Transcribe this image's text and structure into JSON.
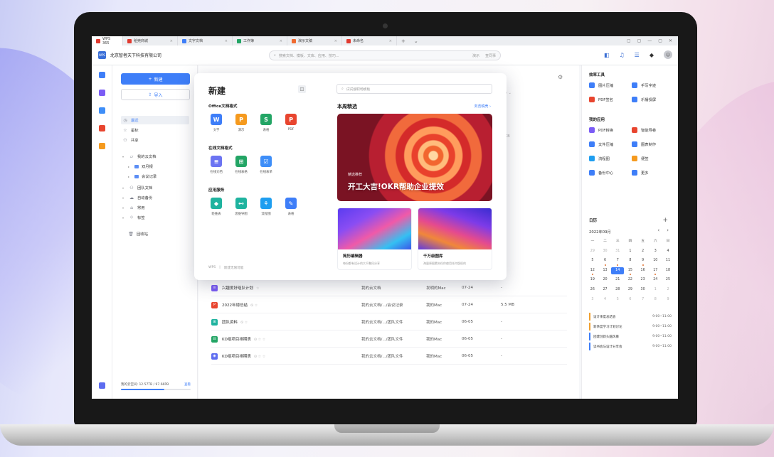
{
  "tabs": [
    {
      "label": "WPS 365",
      "color": "#e13a2f"
    },
    {
      "label": "稻壳商城",
      "color": "#e13a2f"
    },
    {
      "label": "文字文档",
      "color": "#3e7ef8"
    },
    {
      "label": "工作簿",
      "color": "#23a565"
    },
    {
      "label": "演示文稿",
      "color": "#f06a2f"
    },
    {
      "label": "未命名",
      "color": "#e13a2f"
    }
  ],
  "tab_plus": "+",
  "tab_more": "⌄",
  "window_controls": [
    "▢",
    "▢",
    "—",
    "▢",
    "✕"
  ],
  "header": {
    "org_logo": "WPS",
    "org_name": "北京智者天下科技有限公司",
    "search_placeholder": "搜索文档、模板、文库、应用、技巧...",
    "search_opt1": "演示",
    "search_opt2": "查同事",
    "avatar": "☺",
    "badge_icon": "◆"
  },
  "sidebar": {
    "new_label": "新建",
    "new_icon": "+",
    "import_label": "导入",
    "import_icon": "⇪",
    "items": [
      {
        "label": "最近",
        "icon": "◷"
      },
      {
        "label": "星标",
        "icon": "☆"
      },
      {
        "label": "共享",
        "icon": "⚇"
      },
      {
        "label": "我的云文档",
        "icon": "▱"
      },
      {
        "label": "双月报",
        "icon": ""
      },
      {
        "label": "会议记录",
        "icon": ""
      },
      {
        "label": "团队文档",
        "icon": "⚇"
      },
      {
        "label": "自动备份",
        "icon": "☁"
      },
      {
        "label": "常用",
        "icon": "⌂"
      },
      {
        "label": "标签",
        "icon": "⬦"
      },
      {
        "label": "回收站",
        "icon": "🗑"
      }
    ],
    "storage_label": "我的云空间: 12.57TB / 97.66PB",
    "storage_link": "查看",
    "storage_fraction": 0.62
  },
  "files": [
    {
      "name": "兴趣爱好组队计划",
      "marks": "☆",
      "location": "我的云文档",
      "owner": "发明的Mac",
      "date": "07-24",
      "size": "-",
      "color": "#7b5cf5",
      "glyph": "≡"
    },
    {
      "name": "2022年總总结",
      "marks": "⊙  ☆",
      "location": "我的云文档/.../会议记录",
      "owner": "我的Mac",
      "date": "07-24",
      "size": "5.5 MB",
      "color": "#e8452f",
      "glyph": "P"
    },
    {
      "name": "团队资料",
      "marks": "⊙  ☆",
      "location": "我的云文档/.../团队文件",
      "owner": "我的Mac",
      "date": "06-05",
      "size": "-",
      "color": "#1fb39f",
      "glyph": "⊞"
    },
    {
      "name": "KD组项目排期表",
      "marks": "⊙  ☆  ☆",
      "location": "我的云文档/.../团队文件",
      "owner": "我的Mac",
      "date": "06-05",
      "size": "-",
      "color": "#23a565",
      "glyph": "⊟"
    },
    {
      "name": "KD组项目排期表",
      "marks": "⊙  ☆  ☆",
      "location": "我的云文档/.../团队文件",
      "owner": "我的Mac",
      "date": "06-05",
      "size": "-",
      "color": "#5d6cf0",
      "glyph": "◉"
    }
  ],
  "behind": {
    "col_hint": "小 ⌄",
    "size_hint": "KB",
    "gear": "⚙"
  },
  "panel": {
    "title": "新建",
    "toggle_icon": "◫",
    "section1": "Office文档格式",
    "office": [
      {
        "label": "文字",
        "glyph": "W",
        "color": "#3e7ef8"
      },
      {
        "label": "演示",
        "glyph": "P",
        "color": "#f59a1e"
      },
      {
        "label": "表格",
        "glyph": "S",
        "color": "#23a565"
      },
      {
        "label": "PDF",
        "glyph": "P",
        "color": "#e8452f"
      }
    ],
    "section2": "在线文档格式",
    "online": [
      {
        "label": "在线文档",
        "glyph": "≡",
        "color": "#6c74f2"
      },
      {
        "label": "在线表格",
        "glyph": "⊞",
        "color": "#23a565"
      },
      {
        "label": "在线表单",
        "glyph": "☑",
        "color": "#3e8ef8"
      }
    ],
    "section3": "应用服务",
    "apps": [
      {
        "label": "轻维表",
        "glyph": "◆",
        "color": "#1fb39f"
      },
      {
        "label": "思维导图",
        "glyph": "⊷",
        "color": "#1fb39f"
      },
      {
        "label": "流程图",
        "glyph": "⚘",
        "color": "#1f9ef0"
      },
      {
        "label": "表格",
        "glyph": "✎",
        "color": "#3e7ef8"
      }
    ],
    "footer1": "WPS",
    "footer2": "新建无限可能",
    "search_placeholder": "试试搜职场模板",
    "week_title": "本周精选",
    "more_link": "浏览稿壳 ›",
    "banner_tag": "精选推荐",
    "banner_title": "开工大吉!OKR帮助企业提效",
    "cards": [
      {
        "title": "简历编辑器",
        "sub": "每份都有设计的大千整风分享"
      },
      {
        "title": "千万级图库",
        "sub": "海量原图素材任你使用任何版权的"
      }
    ]
  },
  "right": {
    "efficiency_title": "效率工具",
    "efficiency": [
      {
        "label": "图片压缩",
        "color": "#3e7ef8"
      },
      {
        "label": "手写字迹",
        "color": "#3e7ef8"
      },
      {
        "label": "PDF签名",
        "color": "#e8452f"
      },
      {
        "label": "乐播投屏",
        "color": "#3e7ef8"
      }
    ],
    "apps_title": "我的应用",
    "apps": [
      {
        "label": "PDF转换",
        "color": "#7b5cf5"
      },
      {
        "label": "智能导卷",
        "color": "#e8452f"
      },
      {
        "label": "文件压缩",
        "color": "#3e7ef8"
      },
      {
        "label": "图表制作",
        "color": "#3e7ef8"
      },
      {
        "label": "流程图",
        "color": "#1f9ef0"
      },
      {
        "label": "便签",
        "color": "#f59a1e"
      },
      {
        "label": "备份中心",
        "color": "#3e7ef8"
      },
      {
        "label": "更多",
        "color": "#3e7ef8"
      }
    ],
    "calendar_title": "日历",
    "calendar_plus": "+",
    "month": "2022年09月",
    "prev": "‹",
    "next": "›",
    "weekdays": [
      "一",
      "二",
      "三",
      "四",
      "五",
      "六",
      "日"
    ],
    "rows": [
      [
        "29",
        "30",
        "31",
        "1",
        "2",
        "3",
        "4"
      ],
      [
        "5",
        "6",
        "7",
        "8",
        "9",
        "10",
        "11"
      ],
      [
        "12",
        "13",
        "14",
        "15",
        "16",
        "17",
        "18"
      ],
      [
        "19",
        "20",
        "21",
        "22",
        "23",
        "24",
        "25"
      ],
      [
        "26",
        "27",
        "28",
        "29",
        "30",
        "1",
        "2"
      ],
      [
        "3",
        "4",
        "5",
        "6",
        "7",
        "8",
        "9"
      ]
    ],
    "events": [
      {
        "title": "设计季度总结会",
        "time": "9:00~11:00"
      },
      {
        "title": "新季度学习计划讨论",
        "time": "9:00~11:00"
      },
      {
        "title": "团建创新头脑风暴",
        "time": "9:00~11:00"
      },
      {
        "title": "读书会与设计分享会",
        "time": "9:00~11:00"
      }
    ]
  }
}
